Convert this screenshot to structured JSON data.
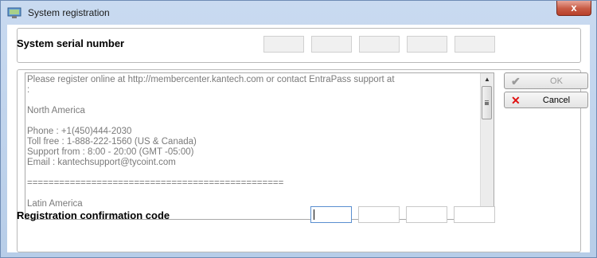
{
  "window": {
    "title": "System registration",
    "close_glyph": "x"
  },
  "serial": {
    "label": "System serial number",
    "fields": [
      "",
      "",
      "",
      "",
      ""
    ]
  },
  "info": {
    "text": "Please register online at http://membercenter.kantech.com or contact EntraPass support at\n:\n\nNorth America\n\nPhone : +1(450)444-2030\nToll free : 1-888-222-1560 (US & Canada)\nSupport from : 8:00 - 20:00 (GMT -05:00)\nEmail : kantechsupport@tycoint.com\n\n================================================\n\nLatin America",
    "scroll_position": 0.0
  },
  "buttons": {
    "ok_label": "OK",
    "ok_icon": "check-icon",
    "ok_enabled": false,
    "cancel_label": "Cancel",
    "cancel_icon": "x-icon"
  },
  "registration": {
    "label": "Registration confirmation code",
    "fields": [
      "",
      "",
      "",
      ""
    ]
  },
  "colors": {
    "title_bar": "#c9daf0",
    "close_button": "#c75a44",
    "cancel_icon": "#e01010",
    "text_gray": "#7a7a7a"
  }
}
